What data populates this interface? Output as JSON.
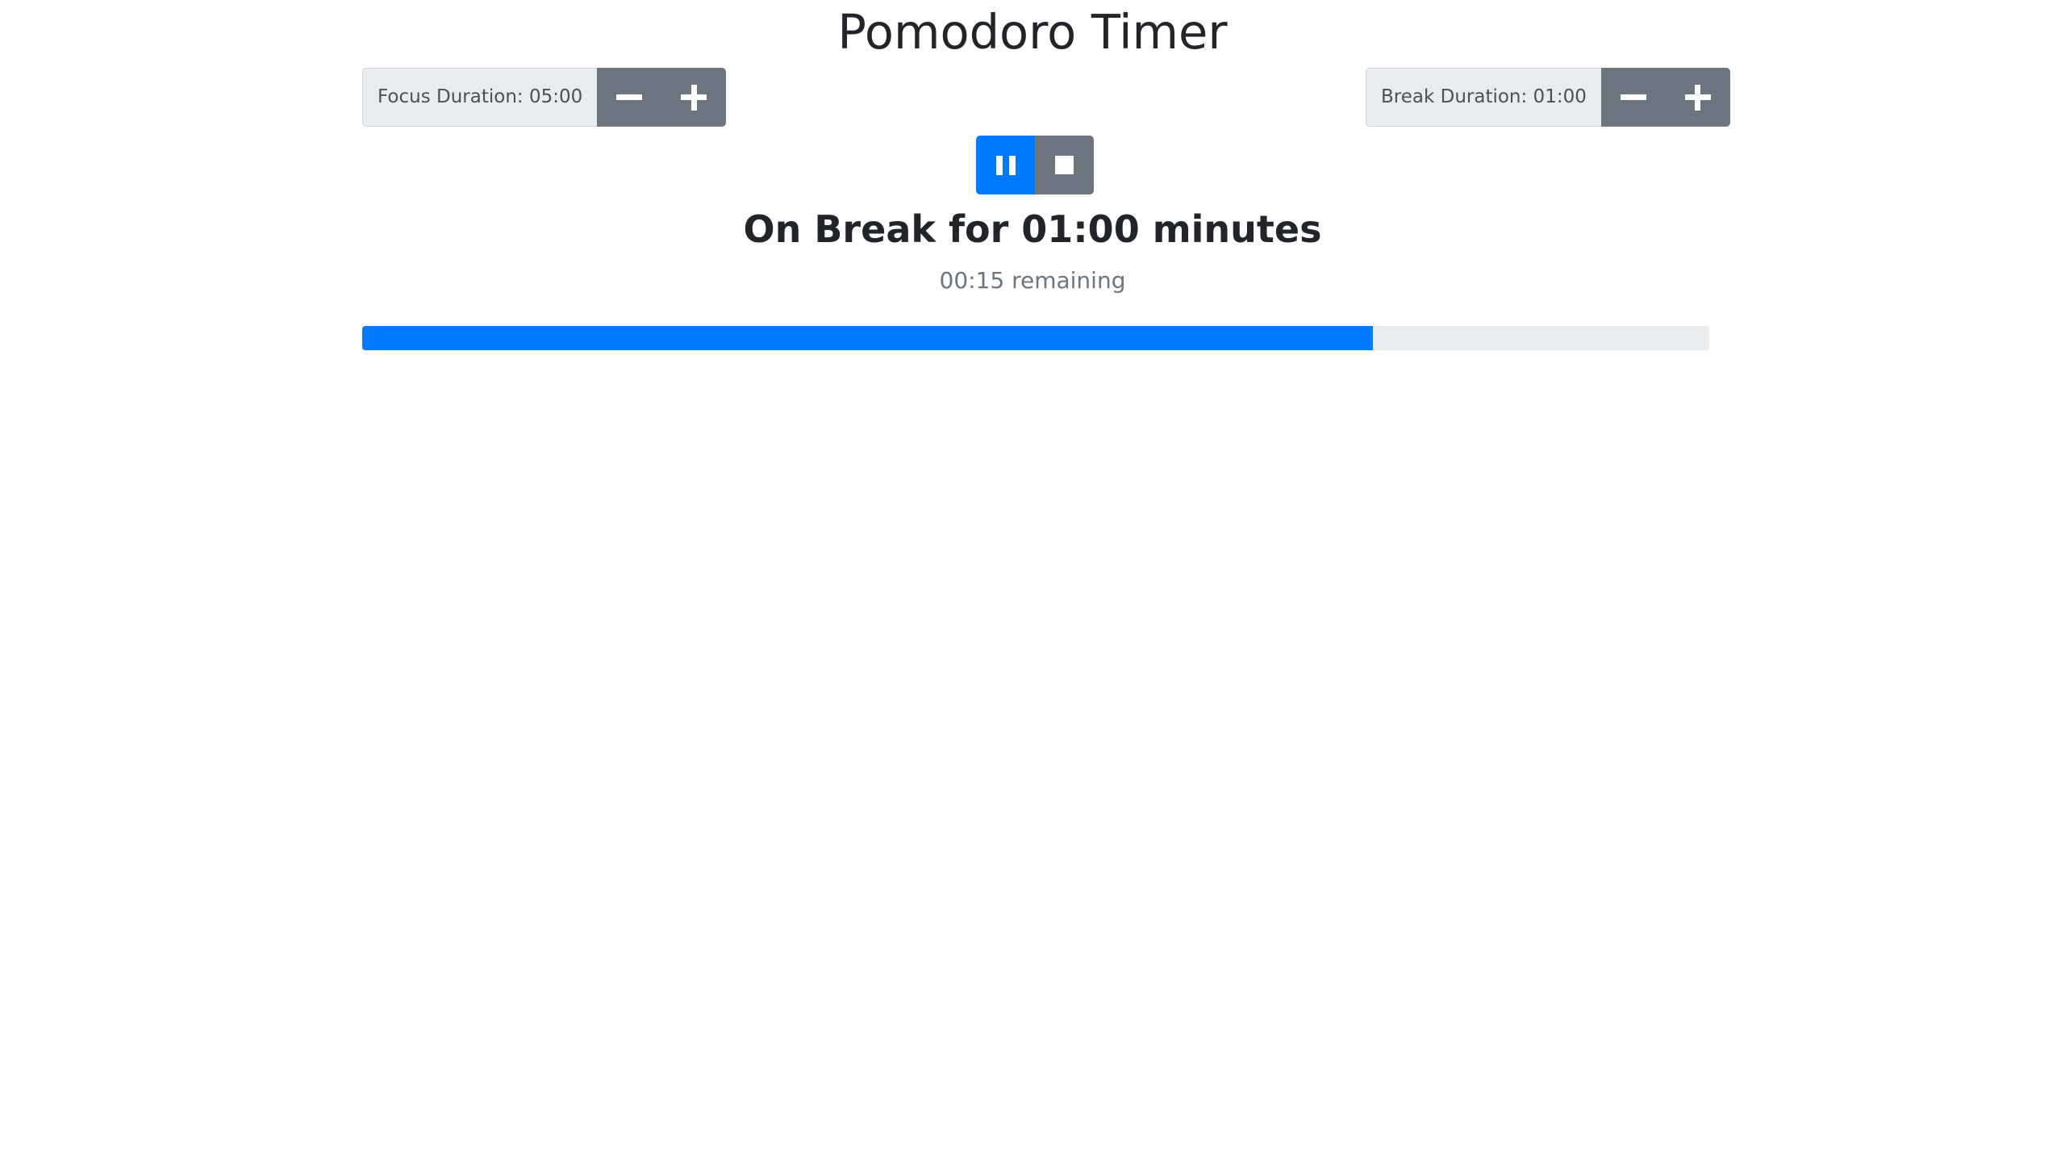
{
  "app": {
    "title": "Pomodoro Timer"
  },
  "focus": {
    "label": "Focus Duration: 05:00",
    "decrease_icon": "minus-icon",
    "increase_icon": "plus-icon"
  },
  "break": {
    "label": "Break Duration: 01:00",
    "decrease_icon": "minus-icon",
    "increase_icon": "plus-icon"
  },
  "controls": {
    "pause_icon": "pause-icon",
    "stop_icon": "stop-icon"
  },
  "timer": {
    "status": "On Break for 01:00 minutes",
    "remaining": "00:15 remaining",
    "progress_percent": 75
  },
  "colors": {
    "primary": "#007bff",
    "secondary": "#6c757d",
    "label_bg": "#e9ecef",
    "progress_track": "#e9ecef",
    "text": "#212529"
  }
}
